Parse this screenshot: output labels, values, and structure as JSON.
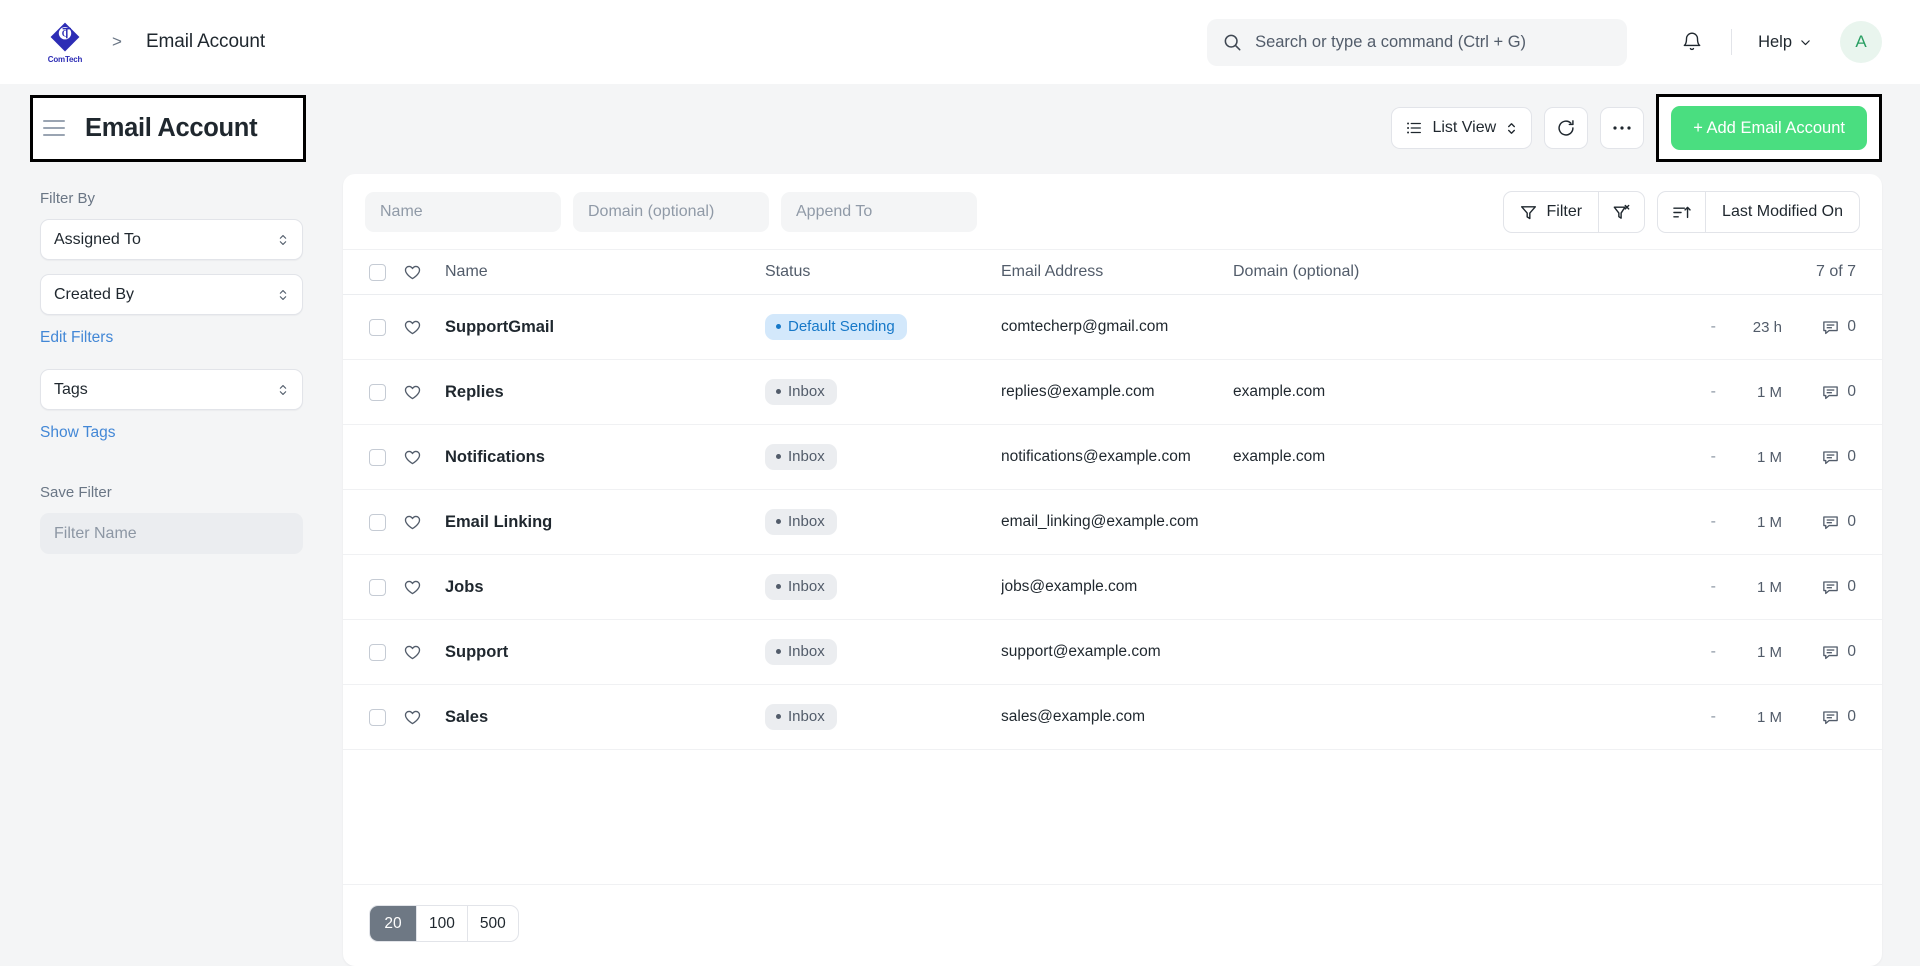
{
  "navbar": {
    "logo_text": "ComTech",
    "logo_mark": "CT",
    "breadcrumb_separator": ">",
    "breadcrumb_current": "Email Account",
    "search_placeholder": "Search or type a command (Ctrl + G)",
    "notifications_icon": "bell-icon",
    "help_label": "Help",
    "avatar_initial": "A"
  },
  "page_head": {
    "menu_icon": "hamburger-icon",
    "title": "Email Account",
    "list_view_label": "List View",
    "refresh_icon": "refresh-icon",
    "more_icon": "ellipsis-icon",
    "add_button_label": "+ Add Email Account",
    "add_button_color": "#4ade80"
  },
  "sidebar": {
    "filter_by_label": "Filter By",
    "assigned_to_label": "Assigned To",
    "created_by_label": "Created By",
    "edit_filters_label": "Edit Filters",
    "tags_label": "Tags",
    "show_tags_label": "Show Tags",
    "save_filter_label": "Save Filter",
    "filter_name_placeholder": "Filter Name",
    "link_color": "#4287d6"
  },
  "toolbar": {
    "name_placeholder": "Name",
    "domain_placeholder": "Domain (optional)",
    "append_to_placeholder": "Append To",
    "filter_label": "Filter",
    "clear_filter_icon": "filter-clear-icon",
    "sort_icon": "sort-ascending-icon",
    "sort_field_label": "Last Modified On"
  },
  "table": {
    "headers": {
      "favorite": "heart-icon",
      "name": "Name",
      "status": "Status",
      "email": "Email Address",
      "domain": "Domain (optional)",
      "count": "7 of 7"
    },
    "rows": [
      {
        "name": "SupportGmail",
        "status": "Default Sending",
        "status_variant": "blue",
        "email": "comtecherp@gmail.com",
        "domain": "",
        "assigned": "-",
        "modified": "23 h",
        "comments": "0"
      },
      {
        "name": "Replies",
        "status": "Inbox",
        "status_variant": "gray",
        "email": "replies@example.com",
        "domain": "example.com",
        "assigned": "-",
        "modified": "1 M",
        "comments": "0"
      },
      {
        "name": "Notifications",
        "status": "Inbox",
        "status_variant": "gray",
        "email": "notifications@example.com",
        "domain": "example.com",
        "assigned": "-",
        "modified": "1 M",
        "comments": "0"
      },
      {
        "name": "Email Linking",
        "status": "Inbox",
        "status_variant": "gray",
        "email": "email_linking@example.com",
        "domain": "",
        "assigned": "-",
        "modified": "1 M",
        "comments": "0"
      },
      {
        "name": "Jobs",
        "status": "Inbox",
        "status_variant": "gray",
        "email": "jobs@example.com",
        "domain": "",
        "assigned": "-",
        "modified": "1 M",
        "comments": "0"
      },
      {
        "name": "Support",
        "status": "Inbox",
        "status_variant": "gray",
        "email": "support@example.com",
        "domain": "",
        "assigned": "-",
        "modified": "1 M",
        "comments": "0"
      },
      {
        "name": "Sales",
        "status": "Inbox",
        "status_variant": "gray",
        "email": "sales@example.com",
        "domain": "",
        "assigned": "-",
        "modified": "1 M",
        "comments": "0"
      }
    ]
  },
  "footer": {
    "page_sizes": [
      "20",
      "100",
      "500"
    ],
    "active_page_size": "20"
  }
}
